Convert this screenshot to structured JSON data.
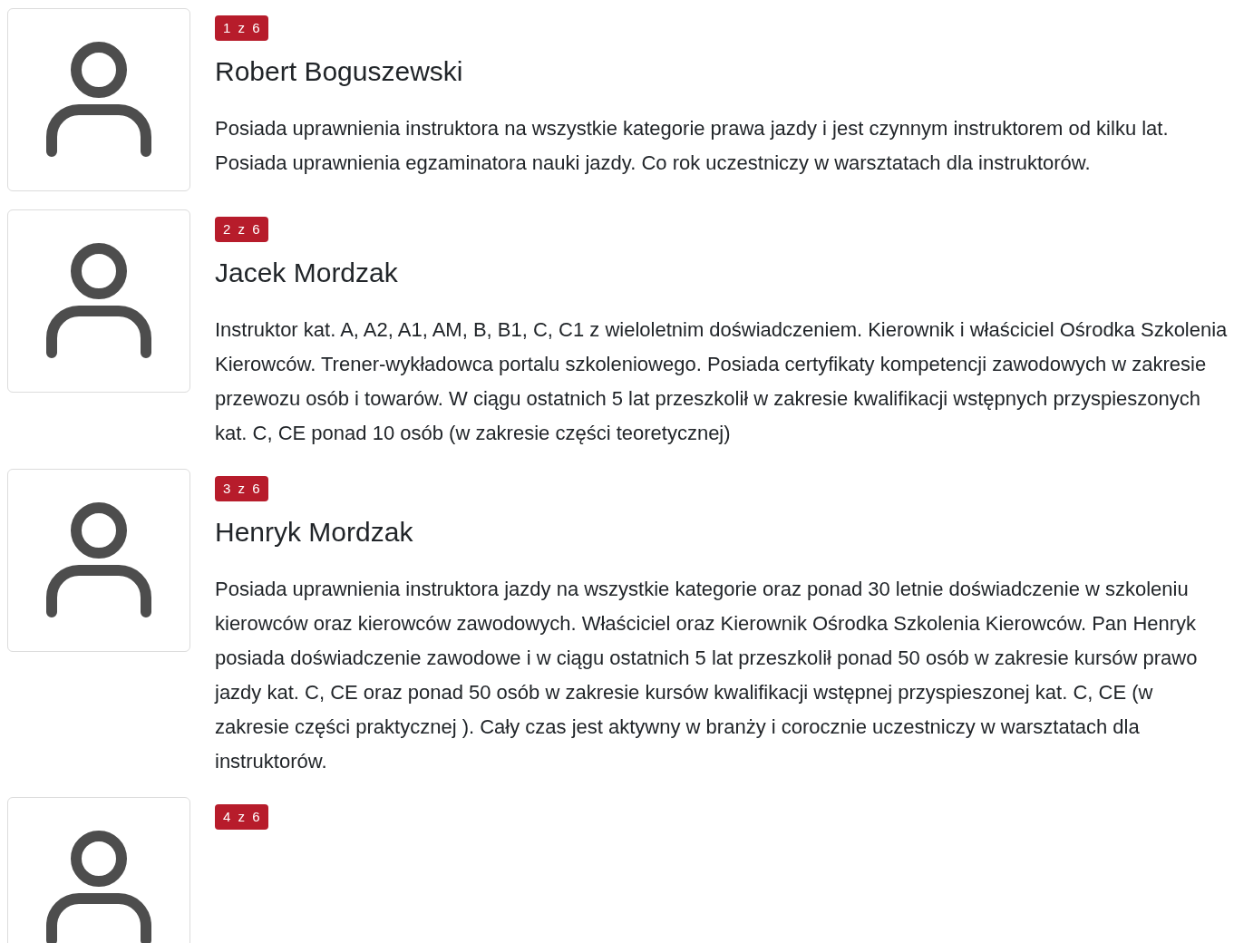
{
  "instructors": [
    {
      "badge": "1 z 6",
      "name": "Robert Boguszewski",
      "bio": "Posiada uprawnienia instruktora na wszystkie kategorie prawa jazdy i jest czynnym instruktorem od kilku lat. Posiada uprawnienia egzaminatora nauki jazdy. Co rok uczestniczy w warsztatach dla instruktorów."
    },
    {
      "badge": "2 z 6",
      "name": "Jacek Mordzak",
      "bio": "Instruktor kat. A, A2, A1, AM, B, B1, C, C1 z wieloletnim doświadczeniem. Kierownik i właściciel Ośrodka Szkolenia Kierowców. Trener-wykładowca portalu szkoleniowego. Posiada certyfikaty kompetencji zawodowych w zakresie przewozu osób i towarów. W ciągu ostatnich 5 lat przeszkolił w zakresie kwalifikacji wstępnych przyspieszonych kat. C, CE ponad 10 osób (w zakresie części teoretycznej)"
    },
    {
      "badge": "3 z 6",
      "name": "Henryk Mordzak",
      "bio": "Posiada uprawnienia instruktora jazdy na wszystkie kategorie oraz ponad 30 letnie doświadczenie w szkoleniu kierowców oraz kierowców zawodowych. Właściciel oraz Kierownik Ośrodka Szkolenia Kierowców. Pan Henryk posiada doświadczenie zawodowe i w ciągu ostatnich 5 lat przeszkolił ponad 50 osób w zakresie kursów prawo jazdy kat. C, CE oraz ponad 50 osób w zakresie kursów kwalifikacji wstępnej przyspieszonej kat. C, CE (w zakresie części praktycznej ). Cały czas jest aktywny w branży i corocznie uczestniczy w warsztatach dla instruktorów."
    },
    {
      "badge": "4 z 6"
    }
  ]
}
